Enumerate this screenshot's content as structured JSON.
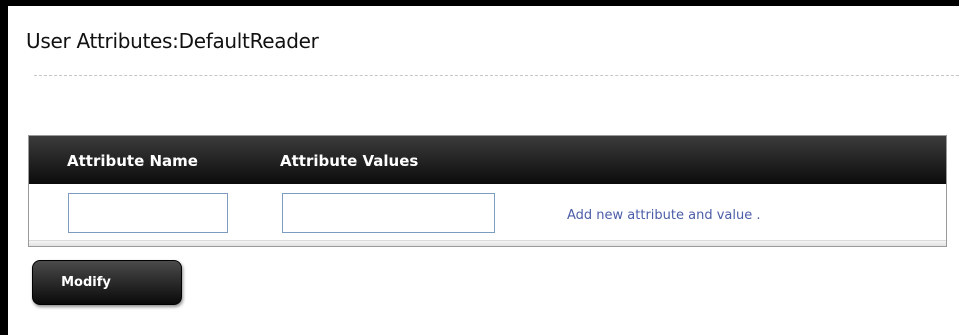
{
  "page": {
    "title": "User Attributes:DefaultReader"
  },
  "attributes_table": {
    "columns": [
      "Attribute Name",
      "Attribute Values"
    ],
    "new_row": {
      "name_value": "",
      "values_value": "",
      "add_link_label": "Add new attribute and value ."
    }
  },
  "actions": {
    "modify_label": "Modify"
  },
  "colors": {
    "header_bg": "#1a1a1a",
    "link": "#4b5ea8",
    "input_border": "#7c9cc0"
  }
}
